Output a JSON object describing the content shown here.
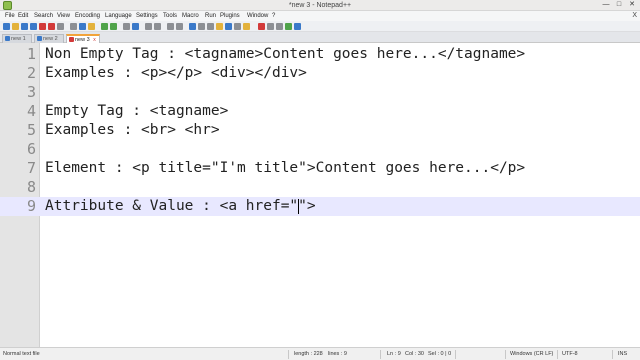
{
  "window": {
    "title": "*new 3 - Notepad++",
    "min_glyph": "—",
    "max_glyph": "□",
    "close_glyph": "✕"
  },
  "menu": {
    "items": [
      "File",
      "Edit",
      "Search",
      "View",
      "Encoding",
      "Language",
      "Settings",
      "Tools",
      "Macro",
      "Run",
      "Plugins",
      "Window",
      "?"
    ],
    "close_glyph": "X"
  },
  "toolbar": {
    "icons": [
      "new-file-icon",
      "open-file-icon",
      "save-icon",
      "save-all-icon",
      "close-icon",
      "close-all-icon",
      "print-icon",
      "cut-icon",
      "copy-icon",
      "paste-icon",
      "undo-icon",
      "redo-icon",
      "find-icon",
      "replace-icon",
      "zoom-in-icon",
      "zoom-out-icon",
      "sync-vertical-icon",
      "sync-horizontal-icon",
      "word-wrap-icon",
      "show-all-chars-icon",
      "indent-guide-icon",
      "user-lang-icon",
      "doc-map-icon",
      "function-list-icon",
      "folder-workspace-icon",
      "record-macro-icon",
      "stop-record-icon",
      "play-macro-icon",
      "run-multiple-macro-icon",
      "save-macro-icon"
    ],
    "colors": {
      "blue": "#3a79c9",
      "green": "#4fa34a",
      "red": "#d23a3a",
      "gray": "#8c8f94",
      "yellow": "#e3b23c"
    }
  },
  "tabs": [
    {
      "label": "new 1",
      "active": false,
      "modified": false
    },
    {
      "label": "new 2",
      "active": false,
      "modified": false
    },
    {
      "label": "new 3",
      "active": true,
      "modified": true
    }
  ],
  "tab_close_glyph": "x",
  "editor": {
    "current_line": 9,
    "lines": [
      {
        "num": "1",
        "text": "Non Empty Tag : <tagname>Content goes here...</tagname>"
      },
      {
        "num": "2",
        "text": "Examples : <p></p> <div></div>"
      },
      {
        "num": "3",
        "text": ""
      },
      {
        "num": "4",
        "text": "Empty Tag : <tagname>"
      },
      {
        "num": "5",
        "text": "Examples : <br> <hr>"
      },
      {
        "num": "6",
        "text": ""
      },
      {
        "num": "7",
        "text": "Element : <p title=\"I'm title\">Content goes here...</p>"
      },
      {
        "num": "8",
        "text": ""
      },
      {
        "num": "9",
        "text": "Attribute & Value : <a href=\"\">"
      }
    ]
  },
  "status": {
    "file_type": "Normal text file",
    "length": "length : 228",
    "lines": "lines : 9",
    "ln": "Ln : 9",
    "col": "Col : 30",
    "sel": "Sel : 0 | 0",
    "eol": "Windows (CR LF)",
    "encoding": "UTF-8",
    "mode": "INS"
  },
  "colors": {
    "tab_accent": "#f2a33a",
    "current_line_bg": "#e8e8ff",
    "gutter_bg": "#e4e4e4",
    "line_number": "#8a8a8a"
  }
}
